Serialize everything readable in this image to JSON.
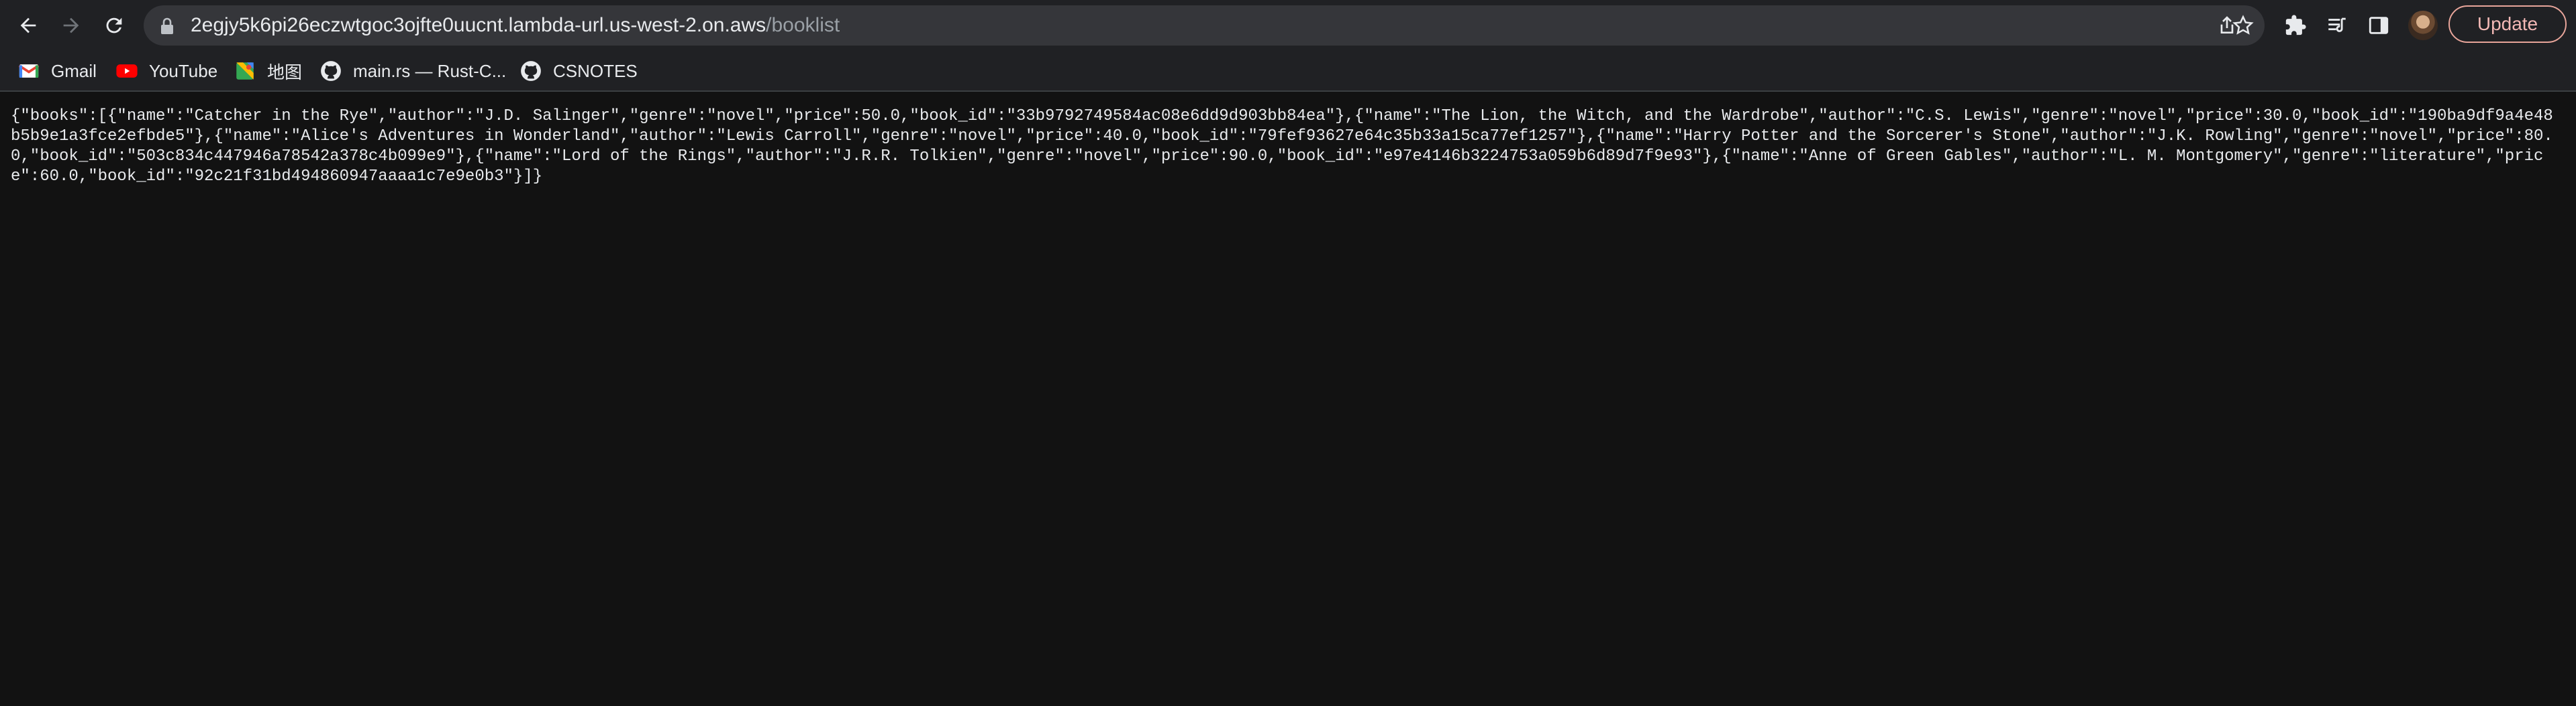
{
  "browser": {
    "url_host": "2egjy5k6pi26eczwtgoc3ojfte0uucnt.lambda-url.us-west-2.on.aws",
    "url_path": "/booklist",
    "update_label": "Update",
    "icons": {
      "back": "arrow-left-icon",
      "forward": "arrow-right-icon",
      "reload": "reload-icon",
      "lock": "lock-icon",
      "share": "share-icon",
      "bookmark": "star-icon",
      "extensions": "puzzle-icon",
      "reading_list": "reading-list-icon",
      "side_panel": "side-panel-icon"
    }
  },
  "bookmarks": [
    {
      "label": "Gmail",
      "icon": "gmail-icon"
    },
    {
      "label": "YouTube",
      "icon": "youtube-icon"
    },
    {
      "label": "地图",
      "icon": "maps-icon"
    },
    {
      "label": "main.rs — Rust-C...",
      "icon": "github-icon"
    },
    {
      "label": "CSNOTES",
      "icon": "github-icon"
    }
  ],
  "page": {
    "json_text": "{\"books\":[{\"name\":\"Catcher in the Rye\",\"author\":\"J.D. Salinger\",\"genre\":\"novel\",\"price\":50.0,\"book_id\":\"33b9792749584ac08e6dd9d903bb84ea\"},{\"name\":\"The Lion, the Witch, and the Wardrobe\",\"author\":\"C.S. Lewis\",\"genre\":\"novel\",\"price\":30.0,\"book_id\":\"190ba9df9a4e48b5b9e1a3fce2efbde5\"},{\"name\":\"Alice's Adventures in Wonderland\",\"author\":\"Lewis Carroll\",\"genre\":\"novel\",\"price\":40.0,\"book_id\":\"79fef93627e64c35b33a15ca77ef1257\"},{\"name\":\"Harry Potter and the Sorcerer's Stone\",\"author\":\"J.K. Rowling\",\"genre\":\"novel\",\"price\":80.0,\"book_id\":\"503c834c447946a78542a378c4b099e9\"},{\"name\":\"Lord of the Rings\",\"author\":\"J.R.R. Tolkien\",\"genre\":\"novel\",\"price\":90.0,\"book_id\":\"e97e4146b3224753a059b6d89d7f9e93\"},{\"name\":\"Anne of Green Gables\",\"author\":\"L. M. Montgomery\",\"genre\":\"literature\",\"price\":60.0,\"book_id\":\"92c21f31bd494860947aaaa1c7e9e0b3\"}]}"
  }
}
